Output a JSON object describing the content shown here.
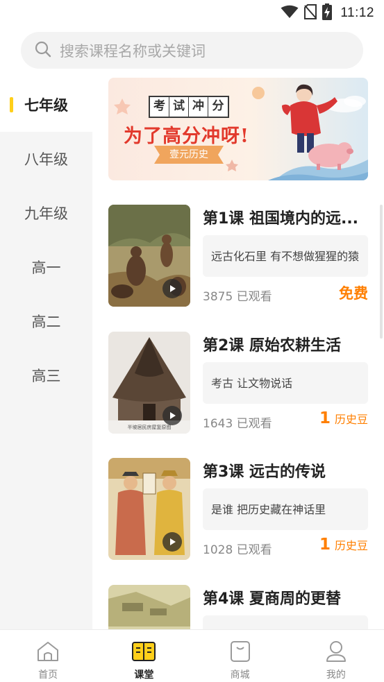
{
  "status_bar": {
    "time": "11:12",
    "icons": [
      "wifi-icon",
      "no-sim-icon",
      "battery-charging-icon"
    ]
  },
  "search": {
    "placeholder": "搜索课程名称或关键词",
    "icon": "search-icon"
  },
  "categories": [
    {
      "label": "七年级",
      "active": true
    },
    {
      "label": "八年级",
      "active": false
    },
    {
      "label": "九年级",
      "active": false
    },
    {
      "label": "高一",
      "active": false
    },
    {
      "label": "高二",
      "active": false
    },
    {
      "label": "高三",
      "active": false
    }
  ],
  "banner": {
    "tag_chars": [
      "考",
      "试",
      "冲",
      "分"
    ],
    "title": "为了高分冲呀!",
    "ribbon": "壹元历史"
  },
  "courses": [
    {
      "title": "第1课 祖国境内的远...",
      "desc": "远古化石里 有不想做猩猩的猿",
      "views": "3875 已观看",
      "price_free": "免费",
      "price_num": "",
      "price_unit": ""
    },
    {
      "title": "第2课 原始农耕生活",
      "desc": "考古 让文物说话",
      "views": "1643 已观看",
      "price_free": "",
      "price_num": "1",
      "price_unit": "历史豆"
    },
    {
      "title": "第3课 远古的传说",
      "desc": "是谁 把历史藏在神话里",
      "views": "1028 已观看",
      "price_free": "",
      "price_num": "1",
      "price_unit": "历史豆"
    },
    {
      "title": "第4课 夏商周的更替",
      "desc": "",
      "views": "",
      "price_free": "",
      "price_num": "",
      "price_unit": ""
    }
  ],
  "thumb_captions": {
    "course2": "半坡居民房屋复原图"
  },
  "bottom_nav": [
    {
      "label": "首页",
      "icon": "home-icon",
      "active": false
    },
    {
      "label": "课堂",
      "icon": "book-icon",
      "active": true
    },
    {
      "label": "商城",
      "icon": "shopping-bag-icon",
      "active": false
    },
    {
      "label": "我的",
      "icon": "user-icon",
      "active": false
    }
  ],
  "colors": {
    "accent": "#ffcf1a",
    "price": "#ff7f00",
    "banner_title": "#e2392c"
  }
}
